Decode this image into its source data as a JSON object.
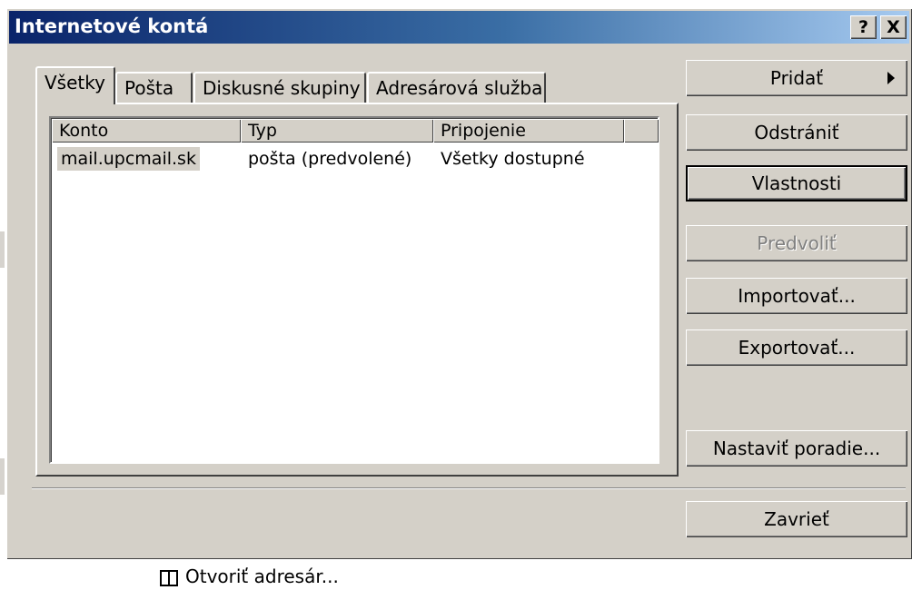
{
  "window": {
    "title": "Internetové kontá",
    "help_label": "?",
    "close_label": "X"
  },
  "tabs": [
    {
      "label": "Všetky",
      "active": true
    },
    {
      "label": "Pošta"
    },
    {
      "label": "Diskusné skupiny"
    },
    {
      "label": "Adresárová služba"
    }
  ],
  "accounts_table": {
    "columns": [
      "Konto",
      "Typ",
      "Pripojenie"
    ],
    "rows": [
      {
        "account": "mail.upcmail.sk",
        "type": "pošta (predvolené)",
        "connection": "Všetky dostupné",
        "selected": true
      }
    ]
  },
  "buttons": {
    "add": "Pridať",
    "remove": "Odstrániť",
    "properties": "Vlastnosti",
    "set_default": "Predvoliť",
    "import": "Importovať...",
    "export": "Exportovať...",
    "set_order": "Nastaviť poradie...",
    "close": "Zavrieť"
  },
  "bottom_link": {
    "label": "Otvoriť adresár...",
    "icon": "address-book-icon"
  }
}
